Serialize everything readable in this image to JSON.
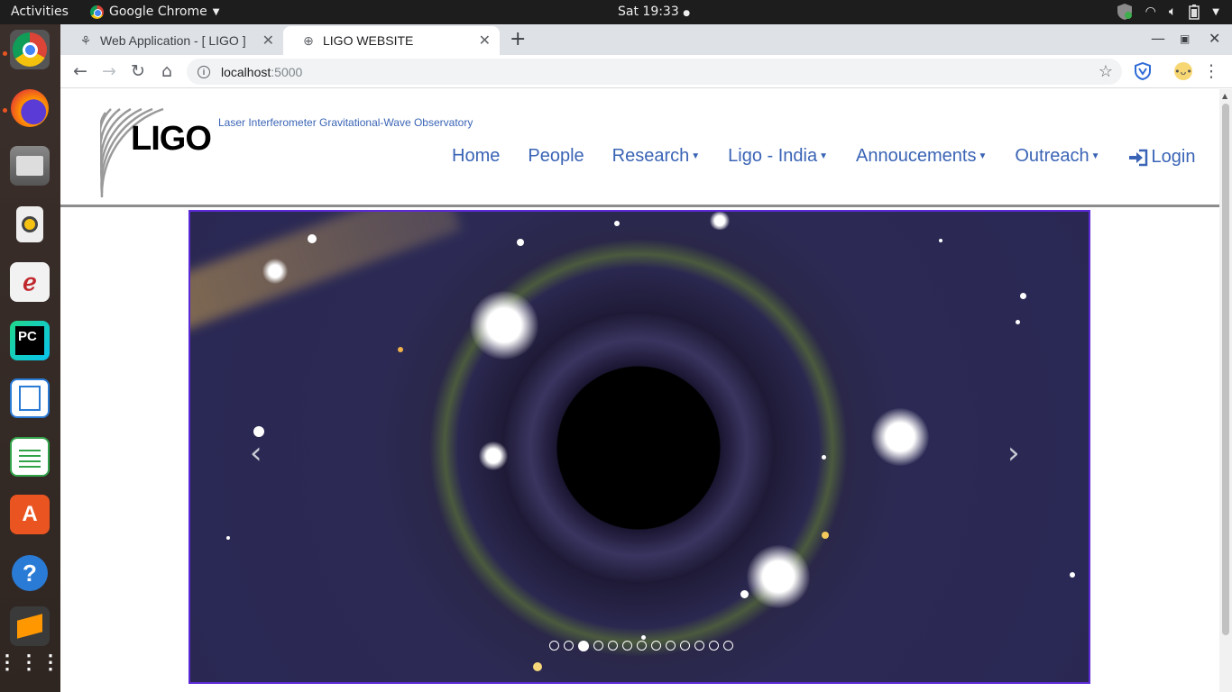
{
  "topbar": {
    "activities": "Activities",
    "app_name": "Google Chrome",
    "clock": "Sat 19:33"
  },
  "dock": {
    "items": [
      "chrome-icon",
      "firefox-icon",
      "files-icon",
      "rhythmbox-icon",
      "document-viewer-icon",
      "pycharm-icon",
      "writer-icon",
      "calc-icon",
      "software-icon",
      "help-icon",
      "sublime-icon",
      "app-grid-icon"
    ]
  },
  "browser": {
    "tabs": [
      {
        "label": "Web Application - [ LIGO ]",
        "active": false
      },
      {
        "label": "LIGO WEBSITE",
        "active": true
      }
    ],
    "address": {
      "host": "localhost",
      "port": ":5000"
    }
  },
  "site": {
    "logo_text": "LIGO",
    "tagline": "Laser Interferometer Gravitational-Wave Observatory",
    "nav": [
      {
        "label": "Home",
        "dropdown": false
      },
      {
        "label": "People",
        "dropdown": false
      },
      {
        "label": "Research",
        "dropdown": true
      },
      {
        "label": "Ligo - India",
        "dropdown": true
      },
      {
        "label": "Annoucements",
        "dropdown": true
      },
      {
        "label": "Outreach",
        "dropdown": true
      }
    ],
    "login_label": "Login",
    "carousel": {
      "slide_count": 13,
      "active_index": 2,
      "accent": "#5b2ad6"
    }
  },
  "colors": {
    "link": "#3a64b5",
    "header_rule": "#8c8c8c"
  }
}
